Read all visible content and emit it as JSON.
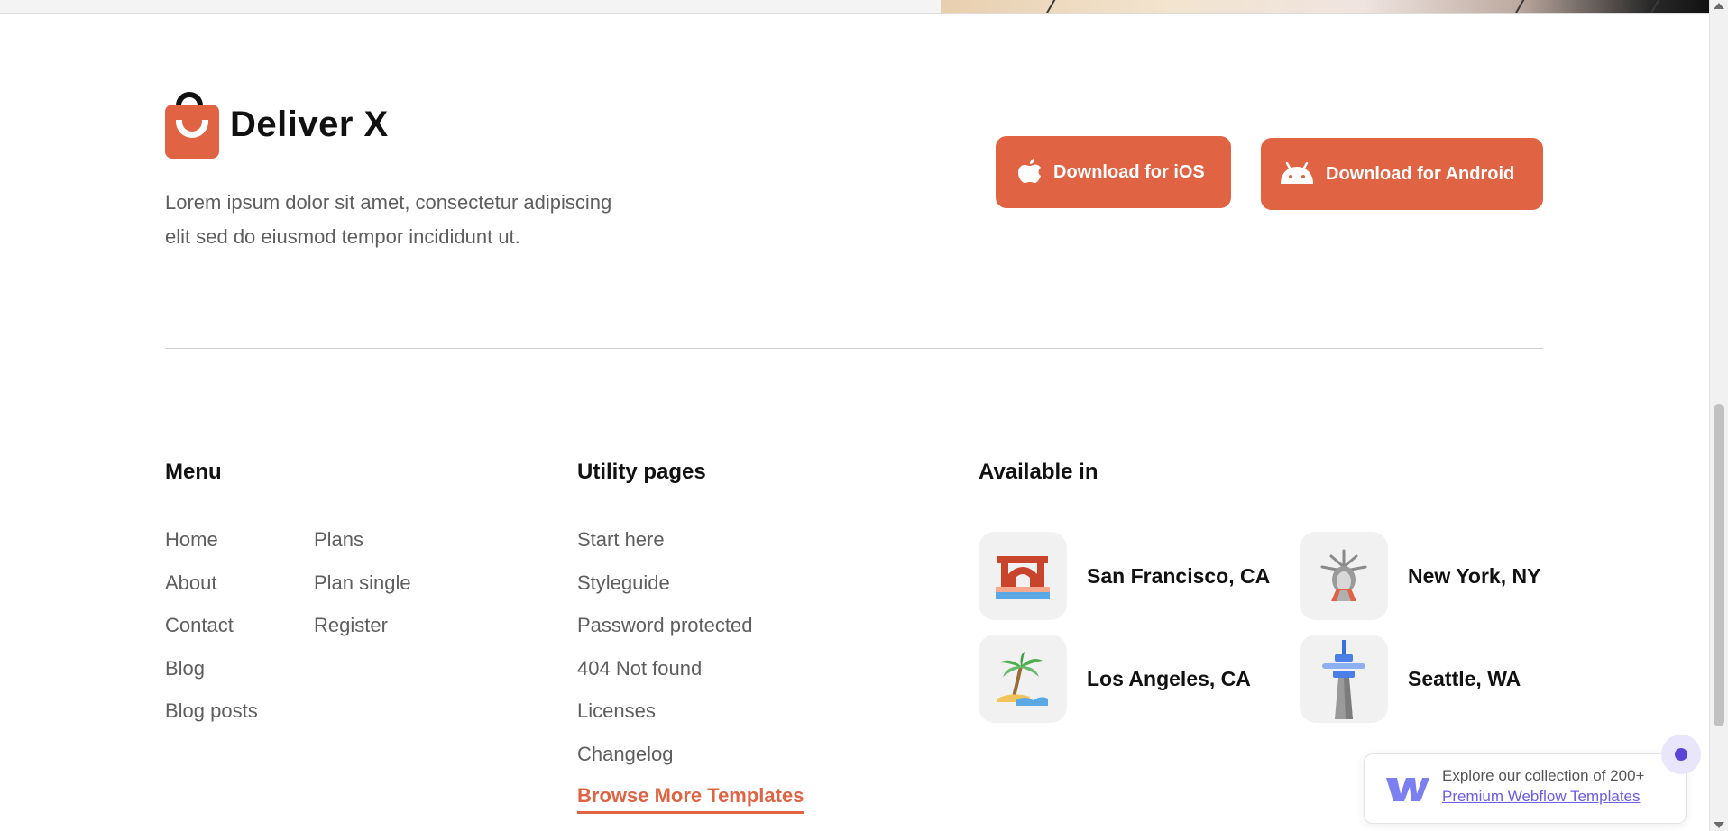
{
  "brand": {
    "name": "Deliver X",
    "accent": "#e06343"
  },
  "footer": {
    "description_line1": "Lorem ipsum dolor sit amet, consectetur adipiscing",
    "description_line2": "elit sed do eiusmod tempor incididunt ut.",
    "download_ios": "Download for iOS",
    "download_android": "Download for Android"
  },
  "menu": {
    "title": "Menu",
    "col1": [
      "Home",
      "About",
      "Contact",
      "Blog",
      "Blog posts"
    ],
    "col2": [
      "Plans",
      "Plan single",
      "Register"
    ]
  },
  "utility": {
    "title": "Utility pages",
    "links": [
      "Start here",
      "Styleguide",
      "Password protected",
      "404 Not found",
      "Licenses",
      "Changelog"
    ],
    "browse": "Browse More Templates"
  },
  "available": {
    "title": "Available in",
    "cities": [
      {
        "name": "San Francisco, CA",
        "icon": "golden-gate-bridge-icon"
      },
      {
        "name": "New York, NY",
        "icon": "statue-of-liberty-icon"
      },
      {
        "name": "Los Angeles, CA",
        "icon": "palm-tree-icon"
      },
      {
        "name": "Seattle, WA",
        "icon": "space-needle-icon"
      }
    ]
  },
  "promo": {
    "line1": "Explore our collection of 200+",
    "line2": "Premium Webflow Templates",
    "icon": "webflow-icon",
    "link_color": "#6c5ce7"
  }
}
